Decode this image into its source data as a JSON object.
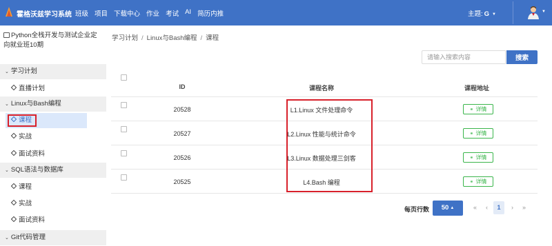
{
  "brand": {
    "name": "霍格沃兹学习系统"
  },
  "nav": {
    "items": [
      "班级",
      "项目",
      "下载中心",
      "作业",
      "考试",
      "AI",
      "简历内推"
    ]
  },
  "header": {
    "theme_label": "主题:",
    "theme_value": "G",
    "accent_color": "#3f72c6"
  },
  "sidebar": {
    "course_title": "Python全栈开发与测试企业定向就业班10期",
    "groups": [
      {
        "label": "学习计划",
        "items": [
          "直播计划"
        ]
      },
      {
        "label": "Linux与Bash编程",
        "items": [
          "课程",
          "实战",
          "面试资料"
        ]
      },
      {
        "label": "SQL语法与数据库",
        "items": [
          "课程",
          "实战",
          "面试资料"
        ]
      },
      {
        "label": "Git代码管理",
        "items": []
      }
    ],
    "active_item": "课程"
  },
  "breadcrumb": [
    "学习计划",
    "Linux与Bash编程",
    "课程"
  ],
  "search": {
    "placeholder": "请输入搜索内容",
    "button_label": "搜索"
  },
  "table": {
    "headers": {
      "id": "ID",
      "name": "课程名称",
      "address": "课程地址"
    },
    "rows": [
      {
        "id": "20528",
        "name": "L1.Linux 文件处理命令",
        "action": "详情"
      },
      {
        "id": "20527",
        "name": "L2.Linux 性能与统计命令",
        "action": "详情"
      },
      {
        "id": "20526",
        "name": "L3.Linux 数据处理三剑客",
        "action": "详情"
      },
      {
        "id": "20525",
        "name": "L4.Bash 编程",
        "action": "详情"
      }
    ]
  },
  "pagination": {
    "rows_per_page_label": "每页行数",
    "rows_per_page": "50",
    "first": "«",
    "prev": "‹",
    "current": "1",
    "next": "›",
    "last": "»"
  }
}
